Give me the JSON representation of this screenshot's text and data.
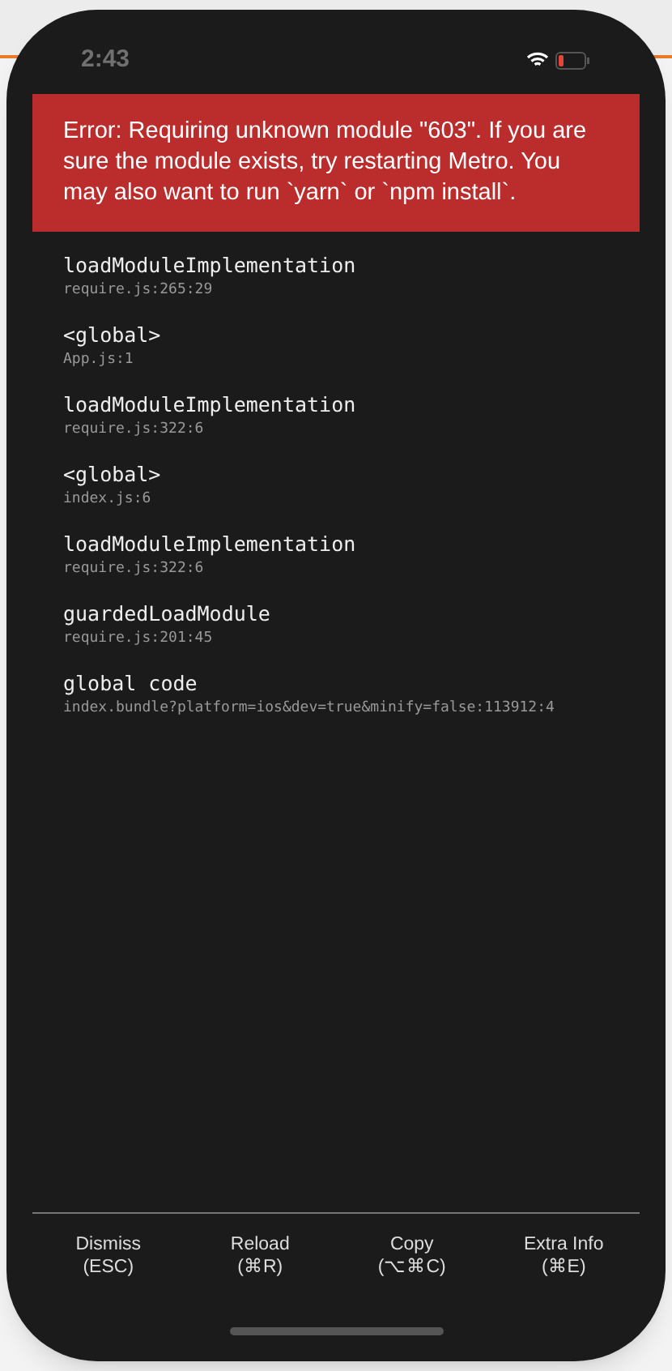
{
  "status_bar": {
    "time": "2:43"
  },
  "error": {
    "message": "Error: Requiring unknown module \"603\". If you are sure the module exists, try restarting Metro. You may also want to run `yarn` or `npm install`."
  },
  "stack": [
    {
      "method": "loadModuleImplementation",
      "location": "require.js:265:29"
    },
    {
      "method": "<global>",
      "location": "App.js:1"
    },
    {
      "method": "loadModuleImplementation",
      "location": "require.js:322:6"
    },
    {
      "method": "<global>",
      "location": "index.js:6"
    },
    {
      "method": "loadModuleImplementation",
      "location": "require.js:322:6"
    },
    {
      "method": "guardedLoadModule",
      "location": "require.js:201:45"
    },
    {
      "method": "global code",
      "location": "index.bundle?platform=ios&dev=true&minify=false:113912:4"
    }
  ],
  "footer_buttons": [
    {
      "label": "Dismiss",
      "shortcut": "(ESC)"
    },
    {
      "label": "Reload",
      "shortcut": "(⌘R)"
    },
    {
      "label": "Copy",
      "shortcut": "(⌥⌘C)"
    },
    {
      "label": "Extra Info",
      "shortcut": "(⌘E)"
    }
  ]
}
